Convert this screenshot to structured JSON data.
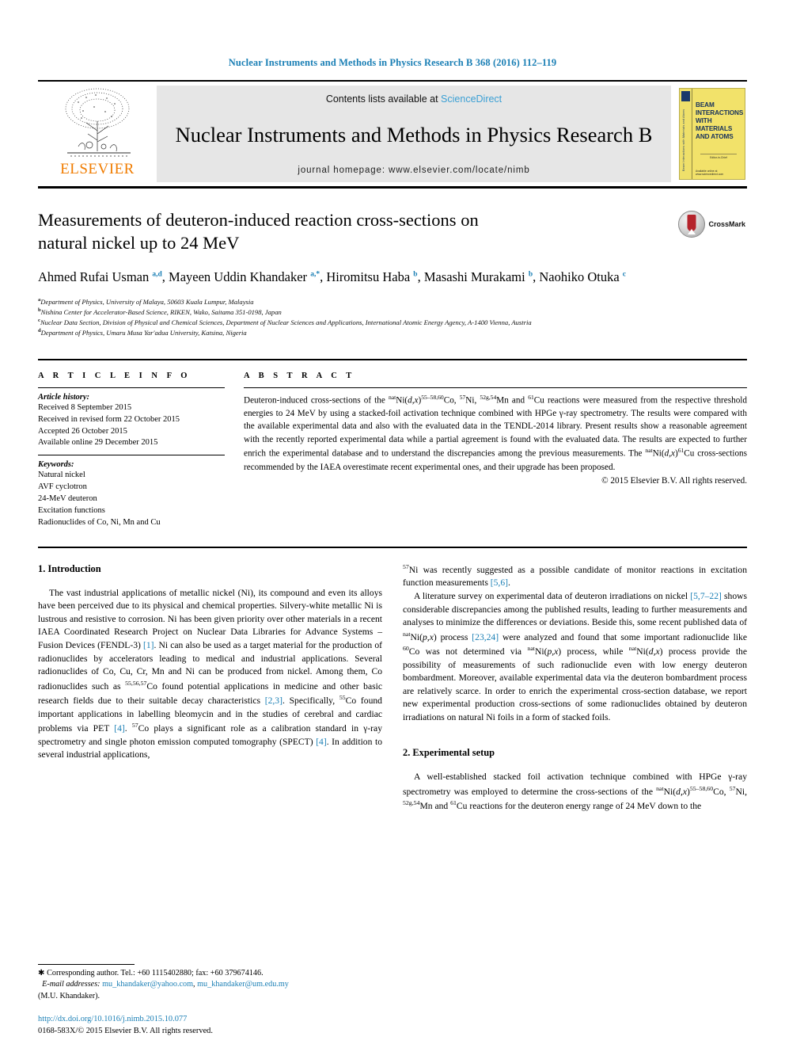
{
  "running_head": "Nuclear Instruments and Methods in Physics Research B 368 (2016) 112–119",
  "masthead": {
    "contents_prefix": "Contents lists available at ",
    "sciencedirect": "ScienceDirect",
    "journal_title": "Nuclear Instruments and Methods in Physics Research B",
    "homepage": "journal homepage: www.elsevier.com/locate/nimb",
    "publisher": "ELSEVIER",
    "cover_title": "BEAM INTERACTIONS WITH MATERIALS AND ATOMS",
    "cover_spine": "Beam Interactions with Materials and Atoms",
    "cover_mid": "Editor-in-Chief",
    "cover_bottom": "Available online at www.sciencedirect.com",
    "link_color": "#3a9fd4",
    "elsevier_orange": "#f07c00",
    "cover_yellow": "#f2e26a"
  },
  "article": {
    "title": "Measurements of deuteron-induced reaction cross-sections on natural nickel up to 24 MeV",
    "crossmark_label": "CrossMark",
    "authors_html": "Ahmed Rufai Usman <sup>a,d</sup>, Mayeen Uddin Khandaker <sup>a,*</sup>, Hiromitsu Haba <sup>b</sup>, Masashi Murakami <sup>b</sup>, Naohiko Otuka <sup>c</sup>",
    "affiliations": [
      {
        "mark": "a",
        "text": "Department of Physics, University of Malaya, 50603 Kuala Lumpur, Malaysia"
      },
      {
        "mark": "b",
        "text": "Nishina Center for Accelerator-Based Science, RIKEN, Wako, Saitama 351-0198, Japan"
      },
      {
        "mark": "c",
        "text": "Nuclear Data Section, Division of Physical and Chemical Sciences, Department of Nuclear Sciences and Applications, International Atomic Energy Agency, A-1400 Vienna, Austria"
      },
      {
        "mark": "d",
        "text": "Department of Physics, Umaru Musa Yar'adua University, Katsina, Nigeria"
      }
    ]
  },
  "article_info": {
    "heading": "A R T I C L E  I N F O",
    "history_title": "Article history:",
    "history": [
      "Received 8 September 2015",
      "Received in revised form 22 October 2015",
      "Accepted 26 October 2015",
      "Available online 29 December 2015"
    ],
    "keywords_title": "Keywords:",
    "keywords": [
      "Natural nickel",
      "AVF cyclotron",
      "24-MeV deuteron",
      "Excitation functions",
      "Radionuclides of Co, Ni, Mn and Cu"
    ]
  },
  "abstract": {
    "heading": "A B S T R A C T",
    "body_html": "Deuteron-induced cross-sections of the <sup>nat</sup>Ni(<i>d,x</i>)<sup>55&ndash;58,60</sup>Co, <sup>57</sup>Ni, <sup>52g,54</sup>Mn and <sup>61</sup>Cu reactions were measured from the respective threshold energies to 24 MeV by using a stacked-foil activation technique combined with HPGe &gamma;-ray spectrometry. The results were compared with the available experimental data and also with the evaluated data in the TENDL-2014 library. Present results show a reasonable agreement with the recently reported experimental data while a partial agreement is found with the evaluated data. The results are expected to further enrich the experimental database and to understand the discrepancies among the previous measurements. The <sup>nat</sup>Ni(<i>d,x</i>)<sup>61</sup>Cu cross-sections recommended by the IAEA overestimate recent experimental ones, and their upgrade has been proposed.",
    "copyright": "© 2015 Elsevier B.V. All rights reserved."
  },
  "body": {
    "section1_heading": "1. Introduction",
    "section1_p1_html": "The vast industrial applications of metallic nickel (Ni), its compound and even its alloys have been perceived due to its physical and chemical properties. Silvery-white metallic Ni is lustrous and resistive to corrosion. Ni has been given priority over other materials in a recent IAEA Coordinated Research Project on Nuclear Data Libraries for Advance Systems &ndash; Fusion Devices (FENDL-3) <span class=\"cit\">[1]</span>. Ni can also be used as a target material for the production of radionuclides by accelerators leading to medical and industrial applications. Several radionuclides of Co, Cu, Cr, Mn and Ni can be produced from nickel. Among them, Co radionuclides such as <sup>55,56,57</sup>Co found potential applications in medicine and other basic research fields due to their suitable decay characteristics <span class=\"cit\">[2,3]</span>. Specifically, <sup>55</sup>Co found important applications in labelling bleomycin and in the studies of cerebral and cardiac problems via PET <span class=\"cit\">[4]</span>. <sup>57</sup>Co plays a significant role as a calibration standard in &gamma;-ray spectrometry and single photon emission computed tomography (SPECT) <span class=\"cit\">[4]</span>. In addition to several industrial applications,",
    "right_p1_html": "<sup>57</sup>Ni was recently suggested as a possible candidate of monitor reactions in excitation function measurements <span class=\"cit\">[5,6]</span>.",
    "right_p2_html": "A literature survey on experimental data of deuteron irradiations on nickel <span class=\"cit\">[5,7&ndash;22]</span> shows considerable discrepancies among the published results, leading to further measurements and analyses to minimize the differences or deviations. Beside this, some recent published data of <sup>nat</sup>Ni(<i>p,x</i>) process <span class=\"cit\">[23,24]</span> were analyzed and found that some important radionuclide like <sup>60</sup>Co was not determined via <sup>nat</sup>Ni(<i>p,x</i>) process, while <sup>nat</sup>Ni(<i>d,x</i>) process provide the possibility of measurements of such radionuclide even with low energy deuteron bombardment. Moreover, available experimental data via the deuteron bombardment process are relatively scarce. In order to enrich the experimental cross-section database, we report new experimental production cross-sections of some radionuclides obtained by deuteron irradiations on natural Ni foils in a form of stacked foils.",
    "section2_heading": "2. Experimental setup",
    "section2_p1_html": "A well-established stacked foil activation technique combined with HPGe &gamma;-ray spectrometry was employed to determine the cross-sections of the <sup>nat</sup>Ni(<i>d,x</i>)<sup>55&ndash;58,60</sup>Co, <sup>57</sup>Ni, <sup>52g,54</sup>Mn and <sup>61</sup>Cu reactions for the deuteron energy range of 24 MeV down to the"
  },
  "footnotes": {
    "corresponding_html": "&#10033; Corresponding author. Tel.: +60 1115402880; fax: +60 379674146.",
    "email_label": "E-mail addresses:",
    "email1": "mu_khandaker@yahoo.com",
    "email2": "mu_khandaker@um.edu.my",
    "email_owner": "(M.U. Khandaker).",
    "doi": "http://dx.doi.org/10.1016/j.nimb.2015.10.077",
    "issn_line": "0168-583X/© 2015 Elsevier B.V. All rights reserved."
  }
}
